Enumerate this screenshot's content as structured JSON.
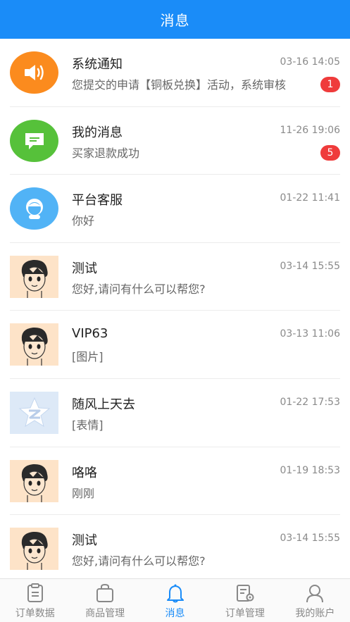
{
  "header": {
    "title": "消息"
  },
  "messages": [
    {
      "name": "系统通知",
      "time": "03-16 14:05",
      "preview": "您提交的申请【铜板兑换】活动，系统审核",
      "badge": "1",
      "avatar": "speaker-icon",
      "avatar_color": "#fb8b1e"
    },
    {
      "name": "我的消息",
      "time": "11-26 19:06",
      "preview": "买家退款成功",
      "badge": "5",
      "avatar": "chat-bubble-icon",
      "avatar_color": "#56c13a"
    },
    {
      "name": "平台客服",
      "time": "01-22 11:41",
      "preview": "你好",
      "badge": "",
      "avatar": "customer-service-icon",
      "avatar_color": "#51b3f6"
    },
    {
      "name": "测试",
      "time": "03-14 15:55",
      "preview": "您好,请问有什么可以帮您?",
      "badge": "",
      "avatar": "cartoon-boy-avatar"
    },
    {
      "name": "VIP63",
      "time": "03-13 11:06",
      "preview": "[图片]",
      "badge": "",
      "avatar": "cartoon-boy-avatar"
    },
    {
      "name": "随风上天去",
      "time": "01-22 17:53",
      "preview": "[表情]",
      "badge": "",
      "avatar": "qzone-star-avatar"
    },
    {
      "name": "咯咯",
      "time": "01-19 18:53",
      "preview": "刚刚",
      "badge": "",
      "avatar": "cartoon-boy-avatar"
    },
    {
      "name": "测试",
      "time": "03-14 15:55",
      "preview": "您好,请问有什么可以帮您?",
      "badge": "",
      "avatar": "cartoon-boy-avatar"
    }
  ],
  "tabs": [
    {
      "label": "订单数据",
      "icon": "clipboard-icon",
      "active": false
    },
    {
      "label": "商品管理",
      "icon": "shopping-bag-icon",
      "active": false
    },
    {
      "label": "消息",
      "icon": "bell-icon",
      "active": true
    },
    {
      "label": "订单管理",
      "icon": "order-settings-icon",
      "active": false
    },
    {
      "label": "我的账户",
      "icon": "user-icon",
      "active": false
    }
  ],
  "colors": {
    "primary": "#1a8cf8",
    "badge": "#ef3b3b"
  }
}
